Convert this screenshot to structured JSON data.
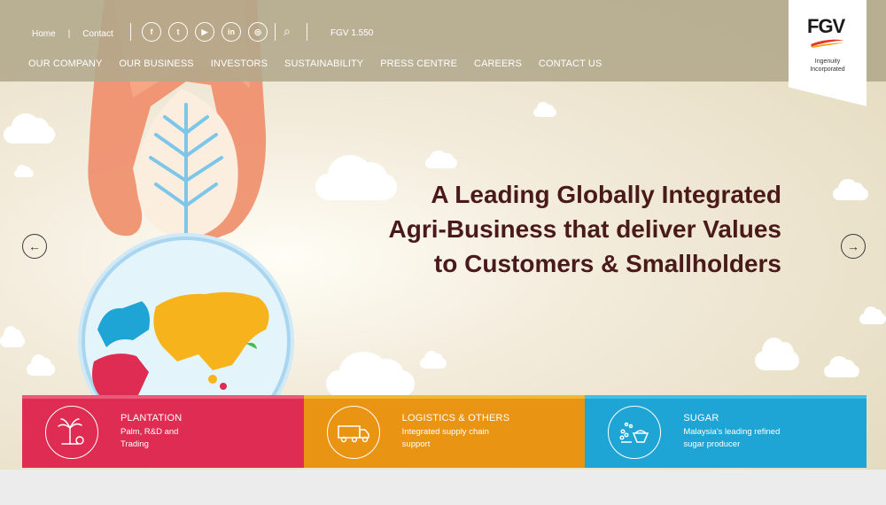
{
  "utility_nav": {
    "home": "Home",
    "contact": "Contact"
  },
  "social": [
    {
      "icon": "facebook-icon",
      "glyph": "f"
    },
    {
      "icon": "twitter-icon",
      "glyph": "t"
    },
    {
      "icon": "youtube-icon",
      "glyph": "▶"
    },
    {
      "icon": "linkedin-icon",
      "glyph": "in"
    },
    {
      "icon": "instagram-icon",
      "glyph": "◎"
    }
  ],
  "search_icon": "⌕",
  "stock": "FGV 1.550",
  "main_nav": [
    "OUR COMPANY",
    "OUR BUSINESS",
    "INVESTORS",
    "SUSTAINABILITY",
    "PRESS CENTRE",
    "CAREERS",
    "CONTACT US"
  ],
  "logo": {
    "name": "FGV",
    "tagline": "Ingenuity Incorporated"
  },
  "hero": {
    "line1": "A Leading Globally Integrated",
    "line2": "Agri-Business that deliver Values",
    "line3": "to Customers & Smallholders"
  },
  "arrows": {
    "prev": "←",
    "next": "→"
  },
  "cards": [
    {
      "title": "PLANTATION",
      "subtitle": "Palm, R&D and Trading",
      "icon": "palm-tree-icon",
      "color": "#de2c52",
      "accent": "#e85a78"
    },
    {
      "title": "LOGISTICS & OTHERS",
      "subtitle": "Integrated supply chain support",
      "icon": "truck-icon",
      "color": "#ea9414",
      "accent": "#f0b833"
    },
    {
      "title": "SUGAR",
      "subtitle": "Malaysia's leading refined sugar producer",
      "icon": "sugar-bowl-icon",
      "color": "#1ea4d5",
      "accent": "#3ec0ea"
    }
  ],
  "colors": {
    "header": "#b2a88c",
    "headline": "#4a1a1a",
    "logo_red": "#e2392b",
    "logo_orange": "#f3a21c"
  }
}
